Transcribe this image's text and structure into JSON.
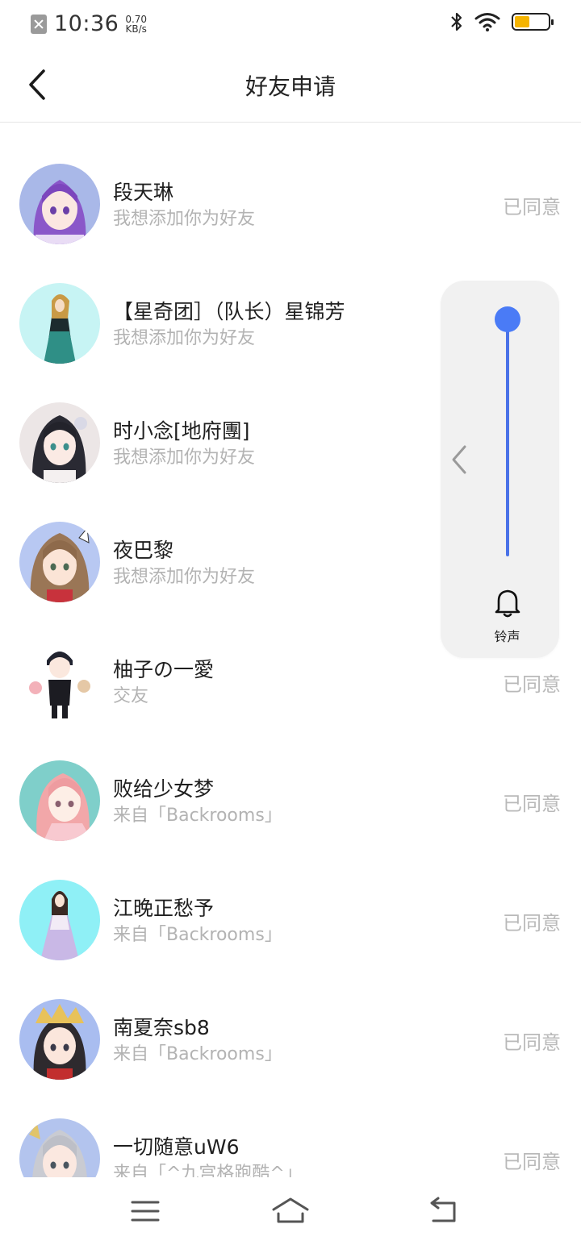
{
  "status_bar": {
    "time": "10:36",
    "net_speed_value": "0.70",
    "net_speed_unit": "KB/s",
    "battery_level": 0.45,
    "icons": [
      "sim-off-icon",
      "bluetooth-icon",
      "wifi-icon",
      "battery-icon"
    ]
  },
  "header": {
    "title": "好友申请",
    "back_icon": "chevron-left-icon"
  },
  "requests": [
    {
      "name": "段天琳",
      "message": "我想添加你为好友",
      "status": "已同意"
    },
    {
      "name": "【星奇团］（队长）星锦芳",
      "message": "我想添加你为好友",
      "status": ""
    },
    {
      "name": "时小念[地府團]",
      "message": "我想添加你为好友",
      "status": ""
    },
    {
      "name": "夜巴黎",
      "message": "我想添加你为好友",
      "status": ""
    },
    {
      "name": "柚子の一愛",
      "message": "交友",
      "status": "已同意"
    },
    {
      "name": "败给少女梦",
      "message": "来自「Backrooms」",
      "status": "已同意"
    },
    {
      "name": "江晚正愁予",
      "message": "来自「Backrooms」",
      "status": "已同意"
    },
    {
      "name": "南夏奈sb8",
      "message": "来自「Backrooms」",
      "status": "已同意"
    },
    {
      "name": "一切随意uW6",
      "message": "来自「^九宫格跑酷^」",
      "status": "已同意"
    }
  ],
  "volume_panel": {
    "label": "铃声",
    "level": 1.0,
    "accent_color": "#4a7bf6",
    "icon": "bell-icon"
  },
  "bottom_nav": {
    "icons": [
      "menu-icon",
      "home-icon",
      "back-icon"
    ]
  }
}
